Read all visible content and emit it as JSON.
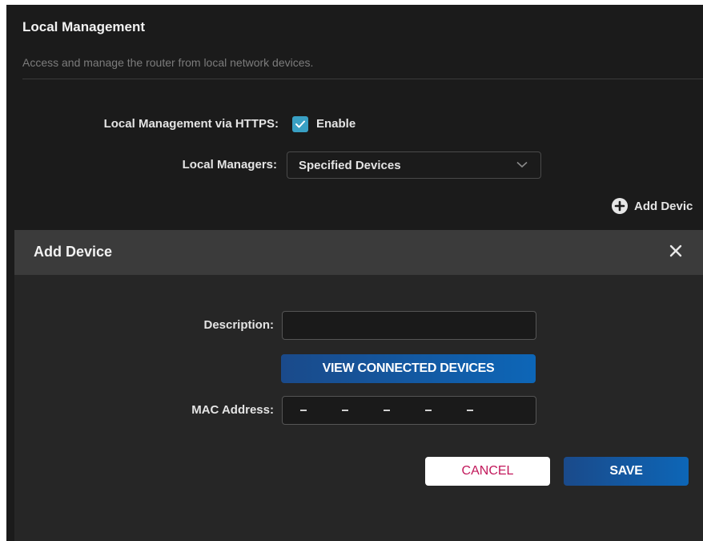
{
  "section": {
    "title": "Local Management",
    "description": "Access and manage the router from local network devices."
  },
  "https_row": {
    "label": "Local Management via HTTPS:",
    "checked": true,
    "checkbox_label": "Enable"
  },
  "managers_row": {
    "label": "Local Managers:",
    "selected": "Specified Devices"
  },
  "add_device_link": {
    "label": "Add Devic"
  },
  "modal": {
    "title": "Add Device",
    "description_label": "Description:",
    "description_value": "",
    "view_button": "VIEW CONNECTED DEVICES",
    "mac_label": "MAC Address:",
    "mac_separators": [
      "-",
      "-",
      "-",
      "-",
      "-"
    ],
    "cancel_button": "CANCEL",
    "save_button": "SAVE"
  },
  "colors": {
    "background": "#1b1b1b",
    "modal_header": "#3b3b3b",
    "checkbox_accent": "#39a0c4",
    "primary_button": "#0d66b7",
    "cancel_text": "#c2185b"
  },
  "icons": [
    "checkmark-icon",
    "chevron-down-icon",
    "plus-circle-icon",
    "close-icon"
  ]
}
